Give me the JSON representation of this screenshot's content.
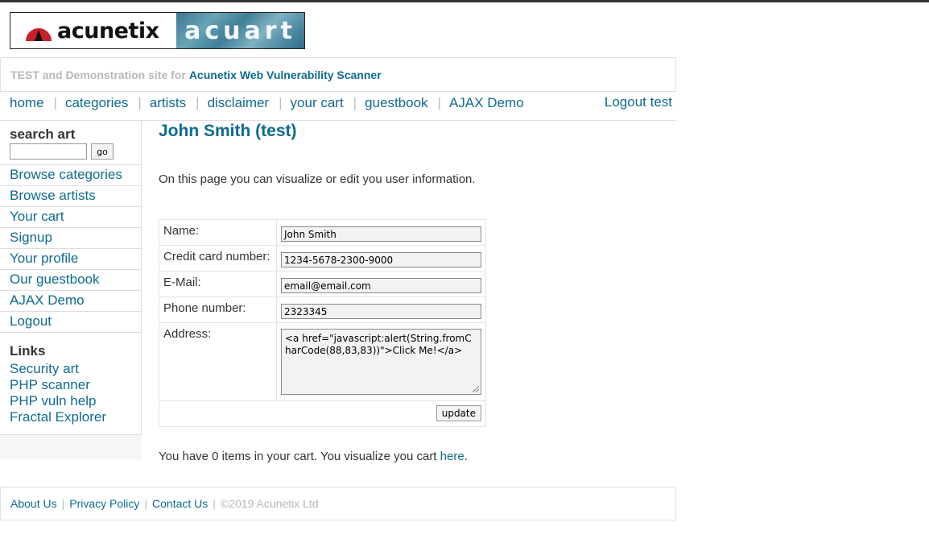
{
  "logo": {
    "left_text": "acunetix",
    "right_text": "acuart"
  },
  "tagline": {
    "prefix": "TEST and Demonstration site for",
    "link": "Acunetix Web Vulnerability Scanner"
  },
  "nav": {
    "items": [
      "home",
      "categories",
      "artists",
      "disclaimer",
      "your cart",
      "guestbook",
      "AJAX Demo"
    ],
    "separator": "|",
    "logout": "Logout test"
  },
  "sidebar": {
    "search_label": "search art",
    "search_value": "",
    "go_label": "go",
    "menu": [
      "Browse categories",
      "Browse artists",
      "Your cart",
      "Signup",
      "Your profile",
      "Our guestbook",
      "AJAX Demo",
      "Logout"
    ],
    "links_title": "Links",
    "links": [
      "Security art",
      "PHP scanner",
      "PHP vuln help",
      "Fractal Explorer"
    ]
  },
  "main": {
    "title": "John Smith (test)",
    "intro": "On this page you can visualize or edit you user information.",
    "form": {
      "name_label": "Name:",
      "name_value": "John Smith",
      "cc_label": "Credit card number:",
      "cc_value": "1234-5678-2300-9000",
      "email_label": "E-Mail:",
      "email_value": "email@email.com",
      "phone_label": "Phone number:",
      "phone_value": "2323345",
      "address_label": "Address:",
      "address_value": "<a href=\"javascript:alert(String.fromCharCode(88,83,83))\">Click Me!</a>",
      "update_label": "update"
    },
    "cart_text": "You have 0 items in your cart. You visualize you cart",
    "cart_link": "here",
    "cart_end": "."
  },
  "footer": {
    "links": [
      "About Us",
      "Privacy Policy",
      "Contact Us"
    ],
    "separator": "|",
    "copyright": "©2019 Acunetix Ltd"
  },
  "colors": {
    "link": "#0e6b8f",
    "muted": "#b8b8b8",
    "logo_red": "#c8202a"
  }
}
